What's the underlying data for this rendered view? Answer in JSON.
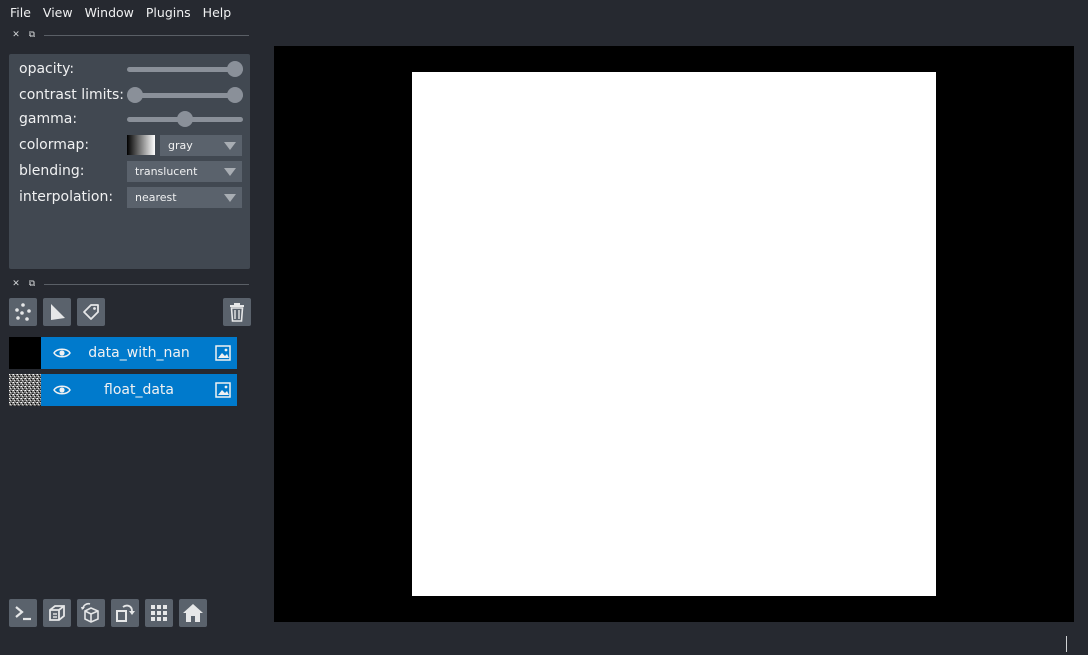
{
  "menu": [
    "File",
    "View",
    "Window",
    "Plugins",
    "Help"
  ],
  "dock_handle": {
    "close_glyph": "✕",
    "float_glyph": "⧉"
  },
  "layer_controls": {
    "opacity_label": "opacity:",
    "opacity_value": 1.0,
    "contrast_label": "contrast limits:",
    "contrast_range": [
      0.0,
      1.0
    ],
    "gamma_label": "gamma:",
    "gamma_value": 0.5,
    "colormap_label": "colormap:",
    "colormap_value": "gray",
    "blending_label": "blending:",
    "blending_value": "translucent",
    "interpolation_label": "interpolation:",
    "interpolation_value": "nearest"
  },
  "layer_buttons": {
    "icons": [
      "new-points-icon",
      "new-shapes-icon",
      "new-labels-icon",
      "delete-layer-icon"
    ]
  },
  "layers": [
    {
      "name": "data_with_nan",
      "thumbnail": "black",
      "visible": true,
      "type_icon": "image-icon"
    },
    {
      "name": "float_data",
      "thumbnail": "noise",
      "visible": true,
      "type_icon": "image-icon"
    }
  ],
  "viewer_buttons": {
    "icons": [
      "console-icon",
      "ndisplay-icon",
      "roll-icon",
      "transpose-icon",
      "grid-icon",
      "home-icon"
    ]
  },
  "colors": {
    "background": "#262930",
    "panel": "#414851",
    "button": "#5a626c",
    "layer_selected": "#007acc",
    "canvas": "#000000",
    "image": "#ffffff"
  }
}
